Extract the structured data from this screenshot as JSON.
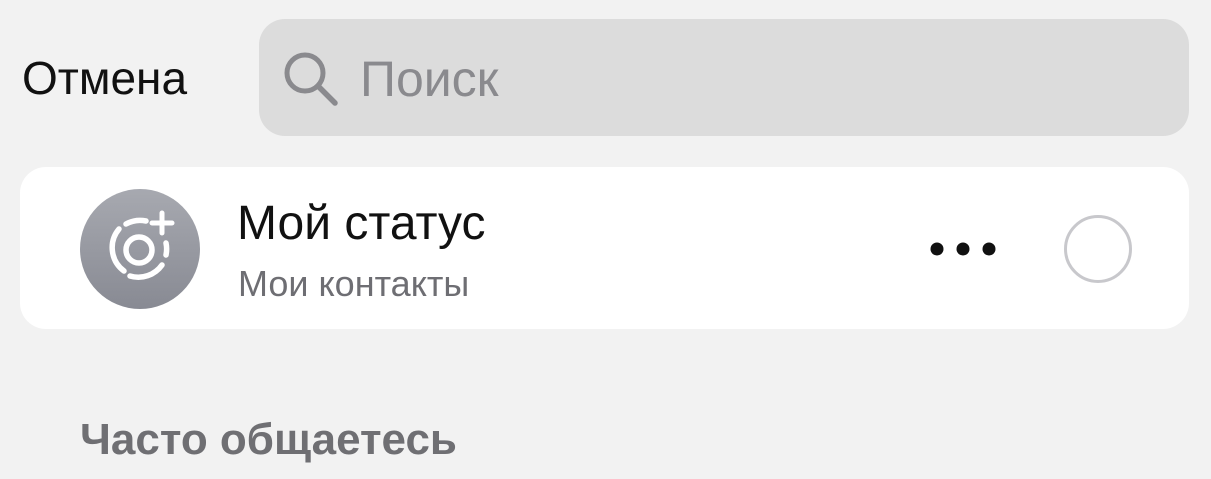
{
  "header": {
    "cancel_label": "Отмена"
  },
  "search": {
    "value": "",
    "placeholder": "Поиск",
    "icon": "magnifying-glass"
  },
  "my_status": {
    "title": "Мой статус",
    "subtitle": "Мои контакты",
    "avatar_icon": "status-add-ring",
    "more_icon": "ellipsis-horizontal",
    "selected": false
  },
  "section": {
    "title": "Часто общаетесь"
  },
  "colors": {
    "background": "#f2f2f2",
    "search_background": "#dcdcdc",
    "card_background": "#ffffff",
    "placeholder": "#8a8a8e",
    "secondary_text": "#6e6e73",
    "avatar_gradient": [
      "#a7a9b0",
      "#888a93"
    ]
  }
}
